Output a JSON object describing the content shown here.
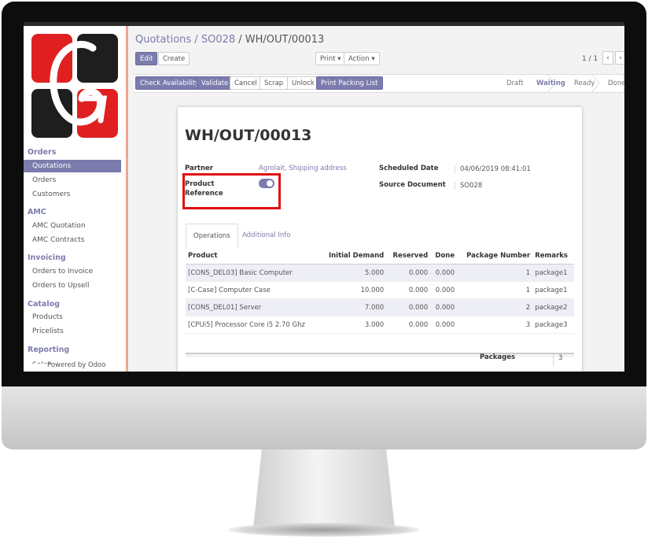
{
  "breadcrumb": {
    "root": "Quotations",
    "sep1": " / ",
    "parent": "SO028",
    "sep2": " / ",
    "current": "WH/OUT/00013"
  },
  "buttons": {
    "edit": "Edit",
    "create": "Create",
    "print": "Print ▾",
    "action": "Action ▾",
    "pager": "1 / 1",
    "prev": "‹",
    "next": "›"
  },
  "actions": {
    "check": "Check Availability",
    "validate": "Validate",
    "cancel": "Cancel",
    "scrap": "Scrap",
    "unlock": "Unlock",
    "print_packing": "Print Packing List"
  },
  "stages": [
    {
      "label": "Draft"
    },
    {
      "label": "Waiting",
      "active": true
    },
    {
      "label": "Ready"
    },
    {
      "label": "Done"
    }
  ],
  "sidebar": {
    "sections": [
      {
        "title": "Orders",
        "items": [
          "Quotations",
          "Orders",
          "Customers"
        ]
      },
      {
        "title": "AMC",
        "items": [
          "AMC Quotation",
          "AMC Contracts"
        ]
      },
      {
        "title": "Invoicing",
        "items": [
          "Orders to Invoice",
          "Orders to Upsell"
        ]
      },
      {
        "title": "Catalog",
        "items": [
          "Products",
          "Pricelists"
        ]
      },
      {
        "title": "Reporting",
        "items": [
          "Sales"
        ]
      }
    ],
    "powered": "Powered by Odoo"
  },
  "form": {
    "title": "WH/OUT/00013",
    "partner_label": "Partner",
    "partner_value": "Agrolait, Shipping address",
    "product_ref_label_1": "Product",
    "product_ref_label_2": "Reference",
    "product_reference": true,
    "scheduled_label": "Scheduled Date",
    "scheduled_value": "04/06/2019 08:41:01",
    "source_label": "Source Document",
    "source_value": "SO028",
    "tabs": [
      "Operations",
      "Additional Info"
    ],
    "columns": [
      "Product",
      "Initial Demand",
      "Reserved",
      "Done",
      "Package Number",
      "Remarks"
    ],
    "rows": [
      [
        "[CONS_DEL03] Basic Computer",
        "5.000",
        "0.000",
        "0.000",
        "1",
        "package1"
      ],
      [
        "[C-Case] Computer Case",
        "10.000",
        "0.000",
        "0.000",
        "1",
        "package1"
      ],
      [
        "[CONS_DEL01] Server",
        "7.000",
        "0.000",
        "0.000",
        "2",
        "package2"
      ],
      [
        "[CPUi5] Processor Core i5 2.70 Ghz",
        "3.000",
        "0.000",
        "0.000",
        "3",
        "package3"
      ]
    ],
    "packages_label": "Packages",
    "packages_value": "3"
  },
  "colors": {
    "accent": "#7c7bad",
    "highlight": "#e01010",
    "sidebar_border": "#f0a58f"
  }
}
